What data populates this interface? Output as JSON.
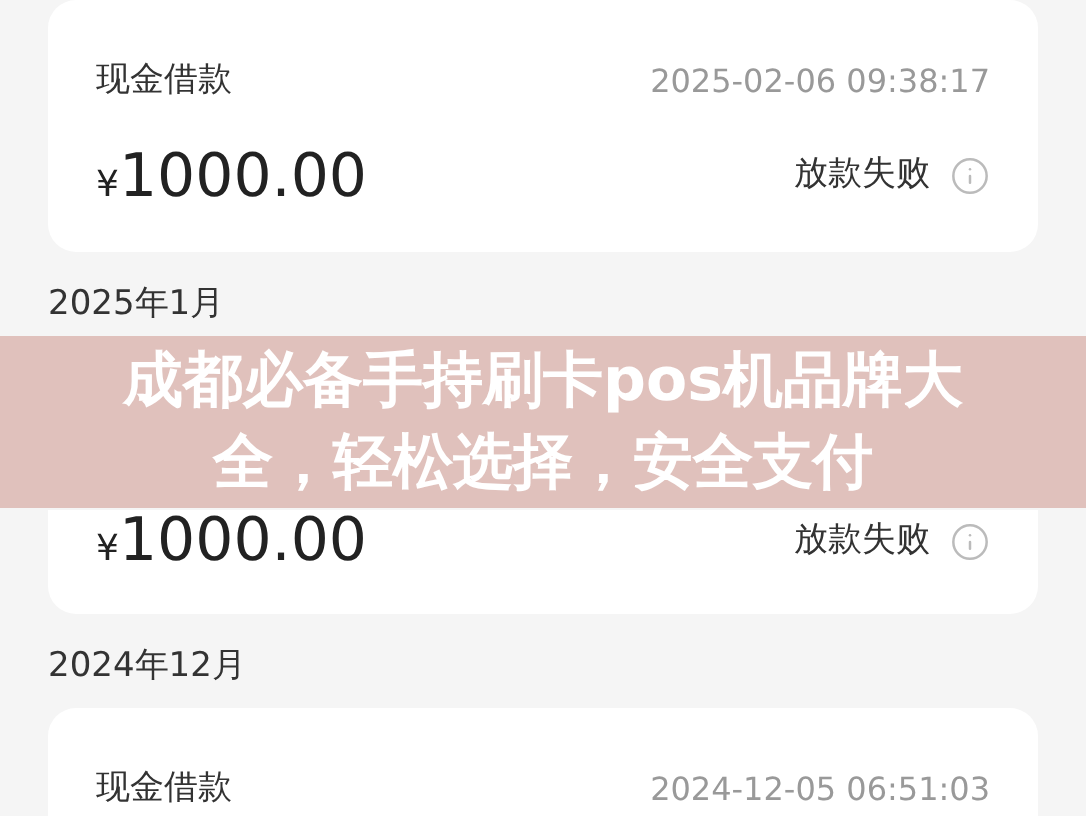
{
  "feed": [
    {
      "kind": "card",
      "title": "现金借款",
      "time": "2025-02-06 09:38:17",
      "currency": "¥",
      "amount": "1000.00",
      "status": "放款失败"
    },
    {
      "kind": "month",
      "label": "2025年1月"
    },
    {
      "kind": "card",
      "currency": "¥",
      "amount": "1000.00",
      "status": "放款失败"
    },
    {
      "kind": "month",
      "label": "2024年12月"
    },
    {
      "kind": "card",
      "title": "现金借款",
      "time": "2024-12-05 06:51:03"
    }
  ],
  "banner": {
    "headline": "成都必备手持刷卡pos机品牌大全，轻松选择，安全支付"
  }
}
